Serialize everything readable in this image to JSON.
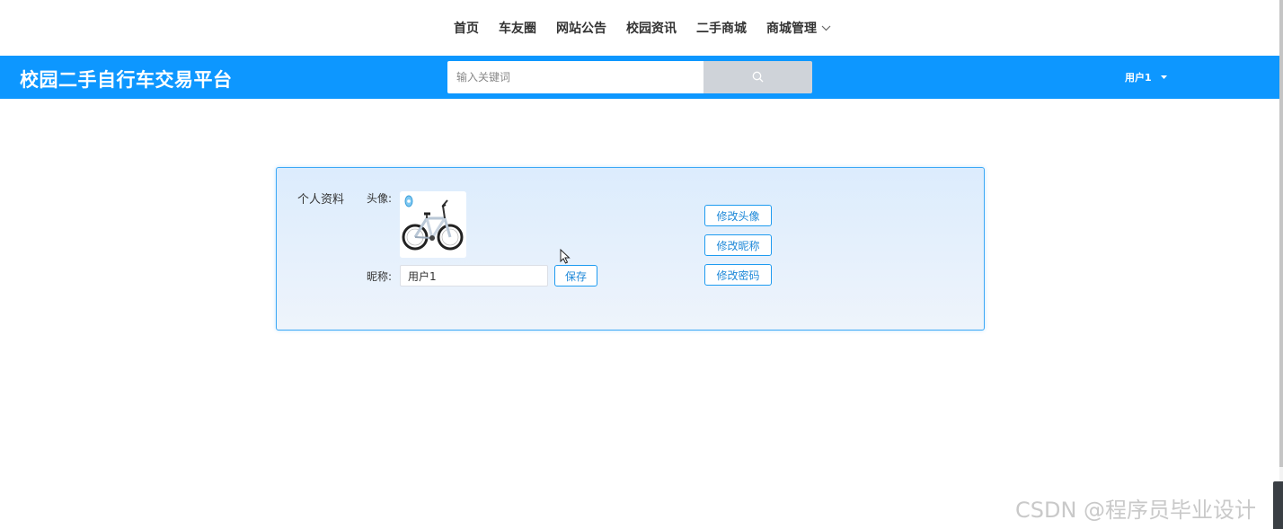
{
  "topnav": {
    "items": [
      {
        "label": "首页"
      },
      {
        "label": "车友圈"
      },
      {
        "label": "网站公告"
      },
      {
        "label": "校园资讯"
      },
      {
        "label": "二手商城"
      },
      {
        "label": "商城管理",
        "has_dropdown": true
      }
    ]
  },
  "header": {
    "brand": "校园二手自行车交易平台",
    "search_placeholder": "输入关键词",
    "search_icon": "search-icon",
    "user_name": "用户1",
    "background_color": "#0d97ff"
  },
  "profile": {
    "section_title": "个人资料",
    "avatar_label": "头像:",
    "avatar_image": "bicycle-photo",
    "nickname_label": "昵称:",
    "nickname_value": "用户1",
    "save_label": "保存",
    "change_avatar_label": "修改头像",
    "change_nickname_label": "修改昵称",
    "change_password_label": "修改密码",
    "accent_color": "#1e9bf0"
  },
  "watermark": "CSDN @程序员毕业设计"
}
